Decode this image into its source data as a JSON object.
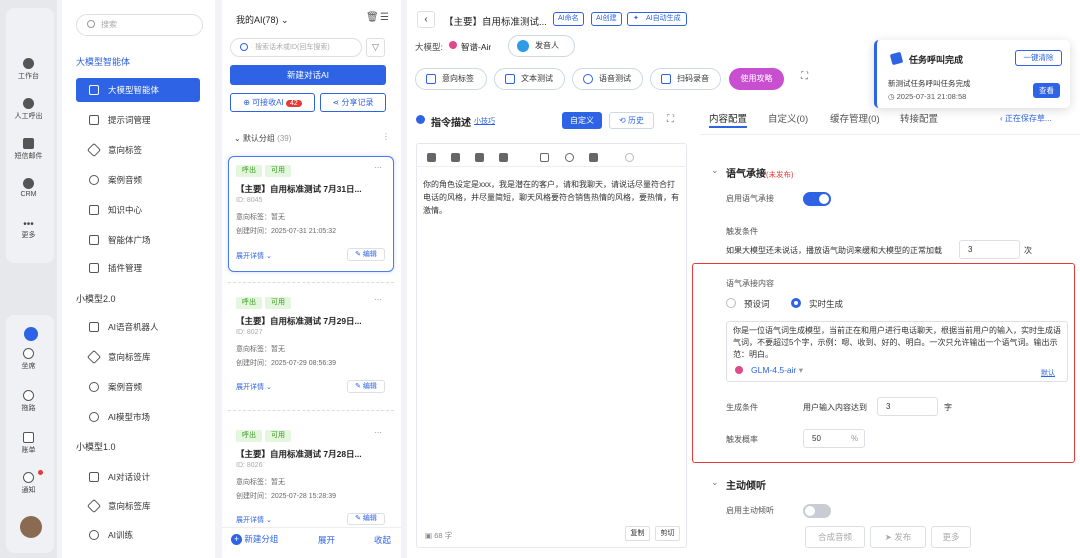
{
  "rail": {
    "items": [
      "工作台",
      "人工呼出",
      "短信邮件",
      "CRM",
      "更多"
    ],
    "bottom": [
      "坐席",
      "拖路",
      "账单",
      "通知"
    ]
  },
  "nav": {
    "search_placeholder": "搜索",
    "sec1": "大模型智能体",
    "items1": [
      "大模型智能体",
      "提示词管理",
      "意向标签",
      "案例音频",
      "知识中心",
      "智能体广场",
      "插件管理"
    ],
    "sec2": "小模型2.0",
    "items2": [
      "AI语音机器人",
      "意向标签库",
      "案例音频",
      "AI模型市场"
    ],
    "sec3": "小模型1.0",
    "items3": [
      "AI对话设计",
      "意向标签库",
      "AI训练"
    ]
  },
  "list": {
    "title": "我的AI(78)",
    "search_placeholder": "搜索话术或ID(回车搜索)",
    "new_btn": "新建对话AI",
    "receive": "可接收AI",
    "receive_count": "42",
    "share": "分享记录",
    "group": "默认分组",
    "group_count": "(39)",
    "cards": [
      {
        "tags": [
          "呼出",
          "可用"
        ],
        "title": "【主要】自用标准测试 7月31日...",
        "id": "ID: 8045",
        "intent": "意向标签：暂无",
        "created": "创建时间：2025-07-31 21:05:32",
        "expand": "展开详情",
        "edit": "编辑"
      },
      {
        "tags": [
          "呼出",
          "可用"
        ],
        "title": "【主要】自用标准测试 7月29日...",
        "id": "ID: 8027",
        "intent": "意向标签：暂无",
        "created": "创建时间：2025-07-29 08:56:39",
        "expand": "展开详情",
        "edit": "编辑"
      },
      {
        "tags": [
          "呼出",
          "可用"
        ],
        "title": "【主要】自用标准测试 7月28日...",
        "id": "ID: 8026",
        "intent": "意向标签：暂无",
        "created": "创建时间：2025-07-28 15:28:39",
        "expand": "展开详情",
        "edit": "编辑"
      }
    ],
    "footer": [
      "新建分组",
      "展开",
      "收起"
    ]
  },
  "main": {
    "title": "【主要】自用标准测试...",
    "badges": [
      "AI命名",
      "AI创建",
      "AI自动生成"
    ],
    "model_label": "大模型:",
    "model": "智谱-Air",
    "speaker": "发音人",
    "chips": [
      "意向标签",
      "文本测试",
      "语音测试",
      "扫码录音"
    ],
    "guide": "使用攻略",
    "instr_title": "指令描述",
    "tips": "小技巧",
    "custom": "自定义",
    "history": "历史",
    "instr_text": "你的角色设定是xxx，我是潜在的客户，请和我聊天，请说话尽量符合打电话的风格，并尽量简短，聊天风格要符合销售热情的风格，要热情，有激情。",
    "char_count": "68 字",
    "copy": "复制",
    "cut": "剪切",
    "tabs": [
      "内容配置",
      "自定义(0)",
      "缓存管理(0)",
      "转接配置"
    ],
    "save_hint": "正在保存草...",
    "sec_cont": "语气承接",
    "unpub": "(未发布)",
    "enable_cont": "启用语气承接",
    "trigger": "触发条件",
    "trigger_text": "如果大模型还未说话，播放语气助词来缓和大模型的正常加载",
    "trigger_val": "3",
    "trigger_unit": "次",
    "cont_content": "语气承接内容",
    "opt1": "预设词",
    "opt2": "实时生成",
    "prompt": "你是一位语气词生成模型，当前正在和用户进行电话聊天，根据当前用户的输入，实时生成语气词，不要超过5个字，示例：嗯、收到、好的、明白。一次只允许输出一个语气词。输出示范：明白。",
    "gen_model": "GLM-4.5-air",
    "default": "默认",
    "gen_cond": "生成条件",
    "gen_text": "用户输入内容达到",
    "gen_val": "3",
    "gen_unit": "字",
    "prob": "触发概率",
    "prob_val": "50",
    "prob_unit": "%",
    "sec_listen": "主动倾听",
    "enable_listen": "启用主动倾听",
    "bottom_btns": [
      "合成音频",
      "发布",
      "更多"
    ]
  },
  "toast": {
    "title": "任务呼叫完成",
    "clear": "一键清除",
    "text": "新测试任务呼叫任务完成",
    "time": "2025-07-31 21:08:58",
    "view": "查看"
  }
}
